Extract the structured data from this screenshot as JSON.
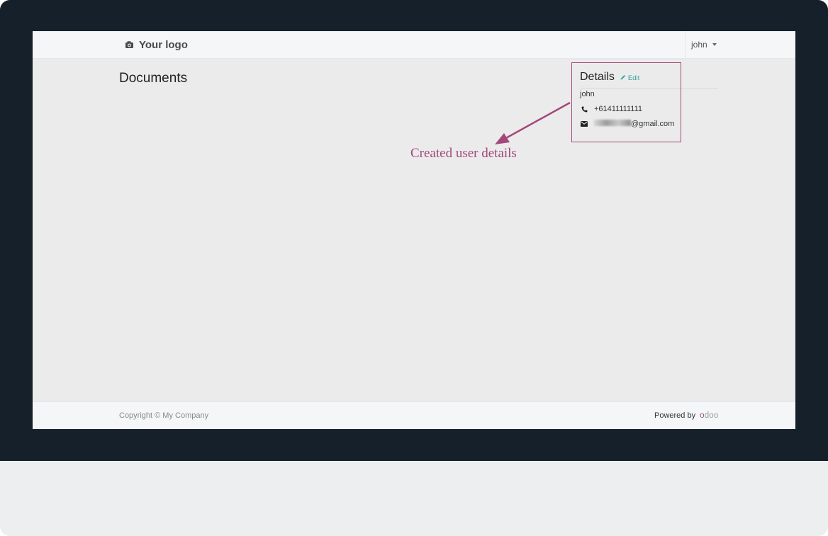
{
  "navbar": {
    "logo_text": "Your logo",
    "user_name": "john"
  },
  "page": {
    "title": "Documents"
  },
  "details": {
    "title": "Details",
    "edit_label": "Edit",
    "name": "john",
    "phone": "+61411111111",
    "email_suffix": "@gmail.com"
  },
  "annotation": {
    "text": "Created user details",
    "color": "#a4487a"
  },
  "footer": {
    "copyright": "Copyright © My Company",
    "powered_by": "Powered by",
    "brand_parts": [
      "o",
      "doo"
    ]
  },
  "colors": {
    "bezel": "#15202b",
    "accent": "#3aa39b",
    "brand": "#8f5b82"
  }
}
